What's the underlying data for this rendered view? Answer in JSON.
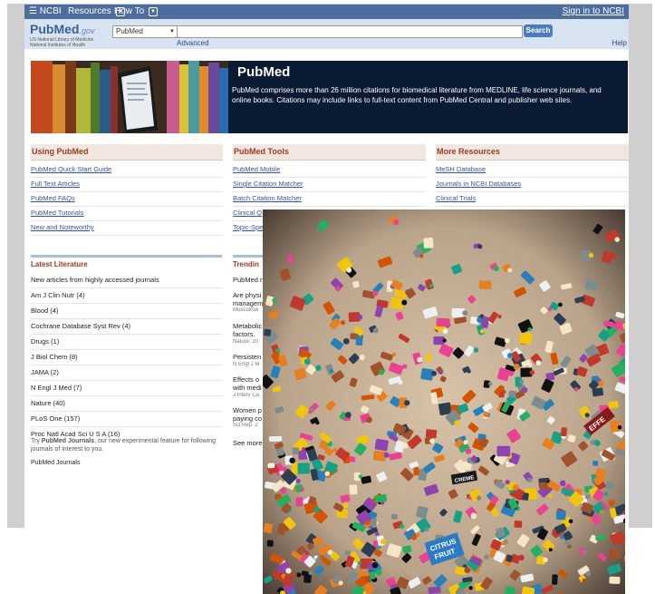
{
  "ncbi_bar": {
    "logo": "NCBI",
    "resources": "Resources",
    "how_to": "How To",
    "sign_in": "Sign in to NCBI"
  },
  "header": {
    "logo_main": "PubMed",
    "logo_gov": ".gov",
    "logo_sub1": "US National Library of Medicine",
    "logo_sub2": "National Institutes of Health",
    "db_select_value": "PubMed",
    "search_placeholder": "",
    "search_button": "Search",
    "advanced": "Advanced",
    "help": "Help"
  },
  "banner": {
    "title": "PubMed",
    "text": "PubMed comprises more than 26 million citations for biomedical literature from MEDLINE, life science journals, and online books. Citations may include links to full-text content from PubMed Central and publisher web sites."
  },
  "using": {
    "title": "Using PubMed",
    "items": [
      "PubMed Quick Start Guide",
      "Full Text Articles",
      "PubMed FAQs",
      "PubMed Tutorials",
      "New and Noteworthy"
    ]
  },
  "tools": {
    "title": "PubMed Tools",
    "items": [
      "PubMed Mobile",
      "Single Citation Matcher",
      "Batch Citation Matcher",
      "Clinical Q",
      "Topic-Spe"
    ]
  },
  "resources": {
    "title": "More Resources",
    "items": [
      "MeSH Database",
      "Journals in NCBI Databases",
      "Clinical Trials"
    ]
  },
  "latest": {
    "title": "Latest Literature",
    "subtitle": "New articles from highly accessed journals",
    "items": [
      "Am J Clin Nutr (4)",
      "Blood (4)",
      "Cochrane Database Syst Rev (4)",
      "Drugs (1)",
      "J Biol Chem (8)",
      "JAMA (2)",
      "N Engl J Med (7)",
      "Nature (40)",
      "PLoS One (157)",
      "Proc Natl Acad Sci U S A (16)"
    ],
    "note_prefix": "Try ",
    "note_bold": "PubMed Journals",
    "note_suffix": ", our new experimental feature for following journals of interest to you.",
    "journals_link": "PubMed Journals"
  },
  "trending": {
    "title": "Trendin",
    "subtitle": "PubMed r",
    "items": [
      {
        "t1": "Are physi",
        "t2": "managem",
        "s": "Musculosk"
      },
      {
        "t1": "Metabolic",
        "t2": "factors.",
        "s": "Nature. 20"
      },
      {
        "t1": "Persisten",
        "t2": "",
        "s": "N Engl J M"
      },
      {
        "t1": "Effects o",
        "t2": "with medi",
        "s": "J Interv Ca"
      },
      {
        "t1": "Women p",
        "t2": "paying co",
        "s": "Sci Rep. 2"
      }
    ],
    "see_more": "See more"
  },
  "photo_text": {
    "label_1": "CITRUS",
    "label_2": "FRUIT",
    "label_3": "CREME",
    "label_4": "EFFE"
  },
  "colors": {
    "ncbi_bar": "#4d6d9c",
    "header": "#d8e3f2",
    "banner": "#0b1a33",
    "section_title": "#9b3b1e",
    "link": "#3a55a0",
    "search_button": "#4f7bb8"
  }
}
